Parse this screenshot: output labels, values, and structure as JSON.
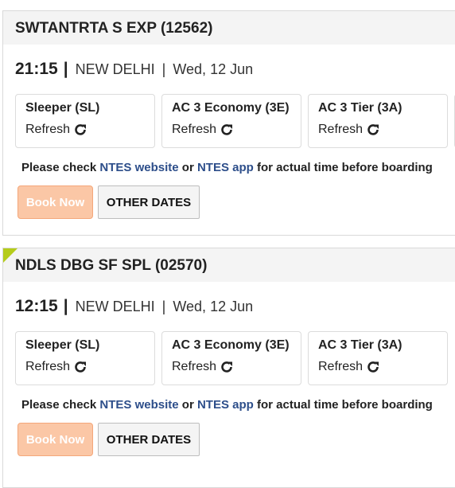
{
  "trains": [
    {
      "name": "SWTANTRTA S EXP (12562)",
      "time": "21:15",
      "separator": "|",
      "station": "NEW DELHI",
      "date_separator": "|",
      "date": "Wed, 12 Jun",
      "classes": [
        {
          "name": "Sleeper (SL)",
          "refresh_label": "Refresh"
        },
        {
          "name": "AC 3 Economy (3E)",
          "refresh_label": "Refresh"
        },
        {
          "name": "AC 3 Tier (3A)",
          "refresh_label": "Refresh"
        }
      ],
      "ntes": {
        "prefix": "Please check",
        "website_link": "NTES website",
        "or": "or",
        "app_link": "NTES app",
        "suffix": "for actual time before boarding"
      },
      "book_now_label": "Book Now",
      "other_dates_label": "OTHER DATES",
      "highlight_flag": false
    },
    {
      "name": "NDLS DBG SF SPL (02570)",
      "time": "12:15",
      "separator": "|",
      "station": "NEW DELHI",
      "date_separator": "|",
      "date": "Wed, 12 Jun",
      "classes": [
        {
          "name": "Sleeper (SL)",
          "refresh_label": "Refresh"
        },
        {
          "name": "AC 3 Economy (3E)",
          "refresh_label": "Refresh"
        },
        {
          "name": "AC 3 Tier (3A)",
          "refresh_label": "Refresh"
        }
      ],
      "ntes": {
        "prefix": "Please check",
        "website_link": "NTES website",
        "or": "or",
        "app_link": "NTES app",
        "suffix": "for actual time before boarding"
      },
      "book_now_label": "Book Now",
      "other_dates_label": "OTHER DATES",
      "highlight_flag": true
    }
  ],
  "colors": {
    "link": "#2d4e8a",
    "book_now_bg": "#fbc7a6",
    "flag": "#b5cc1a",
    "header_bg": "#f4f4f4"
  },
  "icons": {
    "refresh": "refresh-icon"
  }
}
